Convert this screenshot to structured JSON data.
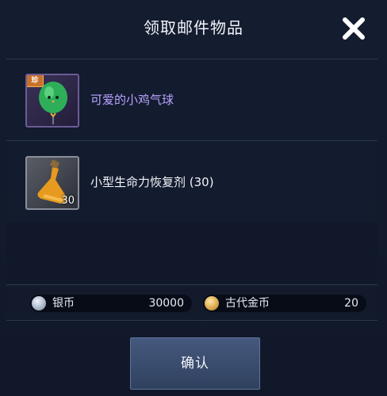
{
  "dialog": {
    "title": "领取邮件物品",
    "close_icon": "close-icon"
  },
  "items": [
    {
      "name": "可爱的小鸡气球",
      "icon": "chick-balloon-icon",
      "badge": "珍",
      "name_color": "#b8a4ff"
    },
    {
      "name": "小型生命力恢复剂 (30)",
      "icon": "potion-flask-icon",
      "quantity": "30",
      "name_color": "#f2f4f8"
    }
  ],
  "currencies": [
    {
      "label": "银币",
      "value": "30000",
      "icon": "silver-coin-icon"
    },
    {
      "label": "古代金币",
      "value": "20",
      "icon": "gold-coin-icon"
    }
  ],
  "confirm_label": "确认",
  "colors": {
    "background": "#0d1424",
    "rare_item": "#b8a4ff",
    "button": "#3a4d6f"
  }
}
